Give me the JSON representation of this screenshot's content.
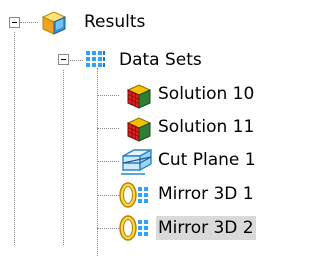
{
  "tree": {
    "root": {
      "label": "Results",
      "icon": "results-cube-icon"
    },
    "data_sets": {
      "label": "Data Sets",
      "icon": "data-sets-grid-icon"
    },
    "items": [
      {
        "label": "Solution 10",
        "icon": "solution-cube-icon"
      },
      {
        "label": "Solution 11",
        "icon": "solution-cube-icon"
      },
      {
        "label": "Cut Plane 1",
        "icon": "cut-plane-icon"
      },
      {
        "label": "Mirror 3D 1",
        "icon": "mirror-3d-icon"
      },
      {
        "label": "Mirror 3D 2",
        "icon": "mirror-3d-icon",
        "selected": true
      }
    ]
  },
  "colors": {
    "selection": "#d9d9d9",
    "guide": "#8a8a8a"
  }
}
